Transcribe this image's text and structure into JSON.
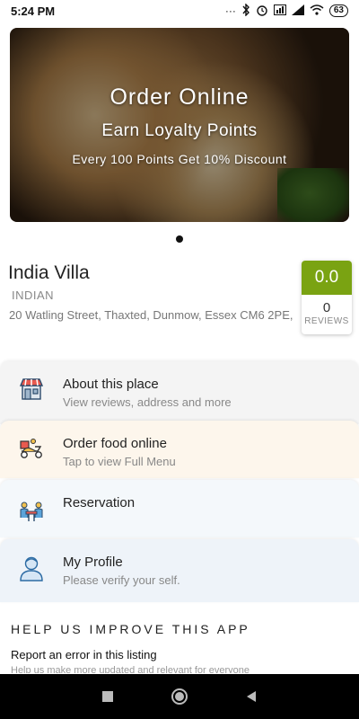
{
  "status_bar": {
    "time": "5:24 PM",
    "battery": "63"
  },
  "hero": {
    "title": "Order Online",
    "subtitle": "Earn Loyalty Points",
    "tagline": "Every 100 Points Get 10% Discount"
  },
  "restaurant": {
    "name": "India Villa",
    "cuisine": "INDIAN",
    "address": "20 Watling Street, Thaxted, Dunmow, Essex CM6 2PE,",
    "rating": "0.0",
    "reviews_count": "0",
    "reviews_label": "REVIEWS",
    "rating_color": "#7aa312"
  },
  "menu": [
    {
      "title": "About this place",
      "subtitle": "View reviews,  address and more",
      "icon": "storefront-icon"
    },
    {
      "title": "Order food online",
      "subtitle": "Tap to view Full Menu",
      "icon": "delivery-scooter-icon"
    },
    {
      "title": "Reservation",
      "subtitle": "",
      "icon": "dining-table-icon"
    },
    {
      "title": "My Profile",
      "subtitle": "Please verify your self.",
      "icon": "user-icon"
    }
  ],
  "help": {
    "title": "HELP US  IMPROVE THIS APP",
    "report_title": "Report an error in this listing",
    "report_subtitle": "Help us make more updated and relevant for everyone"
  }
}
